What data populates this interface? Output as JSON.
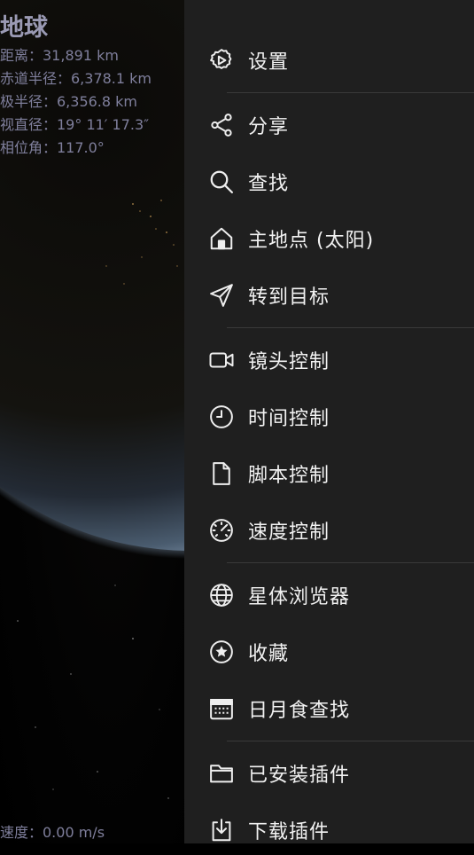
{
  "planet": {
    "name": "地球",
    "distance": "距离：31,891 km",
    "equatorial_radius": "赤道半径：6,378.1 km",
    "polar_radius": "极半径：6,356.8 km",
    "apparent_diameter": "视直径：19° 11′ 17.3″",
    "phase_angle": "相位角：117.0°"
  },
  "speed": "速度：0.00 m/s",
  "menu": {
    "settings": "设置",
    "share": "分享",
    "search": "查找",
    "home": "主地点 (太阳)",
    "goto": "转到目标",
    "camera": "镜头控制",
    "time": "时间控制",
    "script": "脚本控制",
    "speed": "速度控制",
    "browser": "星体浏览器",
    "favorites": "收藏",
    "eclipse": "日月食查找",
    "addons": "已安装插件",
    "download": "下载插件"
  },
  "colors": {
    "drawer_bg": "#1f1f1f",
    "text": "#f2f2f2",
    "info_text": "#7f7f9c"
  }
}
